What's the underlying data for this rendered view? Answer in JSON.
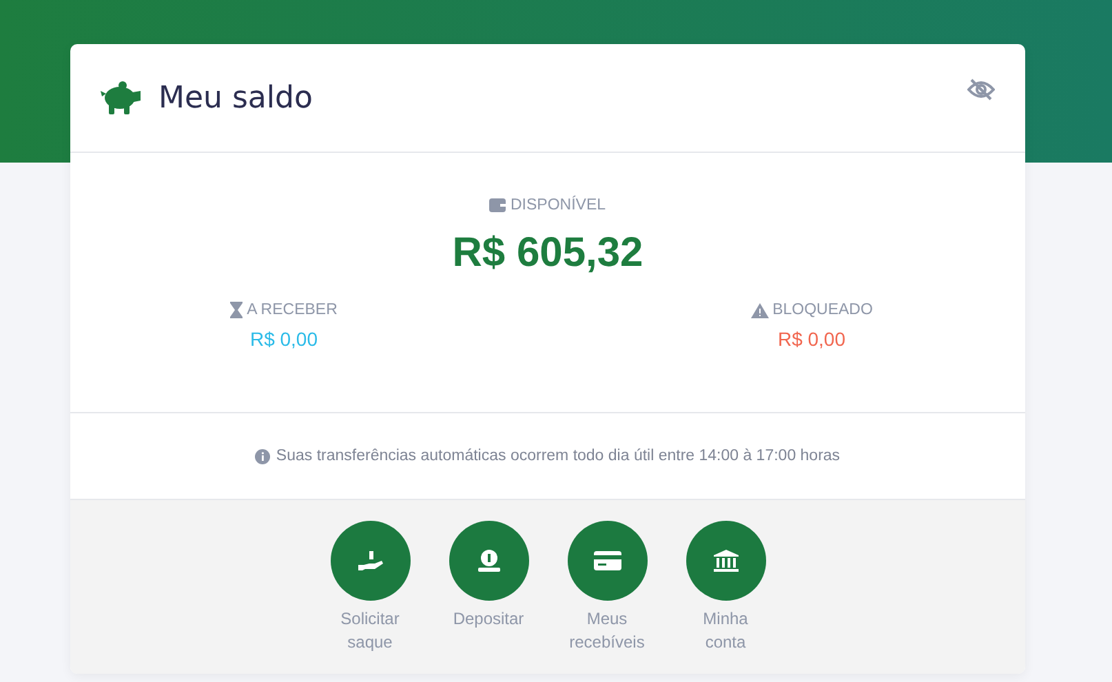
{
  "header": {
    "title": "Meu saldo"
  },
  "available": {
    "label": "DISPONÍVEL",
    "amount": "R$ 605,32"
  },
  "sub_balances": [
    {
      "kind": "pending",
      "label": "A RECEBER",
      "amount": "R$ 0,00",
      "color": "#2bbbe8"
    },
    {
      "kind": "blocked",
      "label": "BLOQUEADO",
      "amount": "R$ 0,00",
      "color": "#f1664f"
    }
  ],
  "info": "Suas transferências automáticas ocorrem todo dia útil entre 14:00 à 17:00 horas",
  "actions": [
    {
      "kind": "withdraw",
      "label": "Solicitar saque"
    },
    {
      "kind": "deposit",
      "label": "Depositar"
    },
    {
      "kind": "card",
      "label": "Meus recebíveis"
    },
    {
      "kind": "bank",
      "label": "Minha conta"
    }
  ]
}
